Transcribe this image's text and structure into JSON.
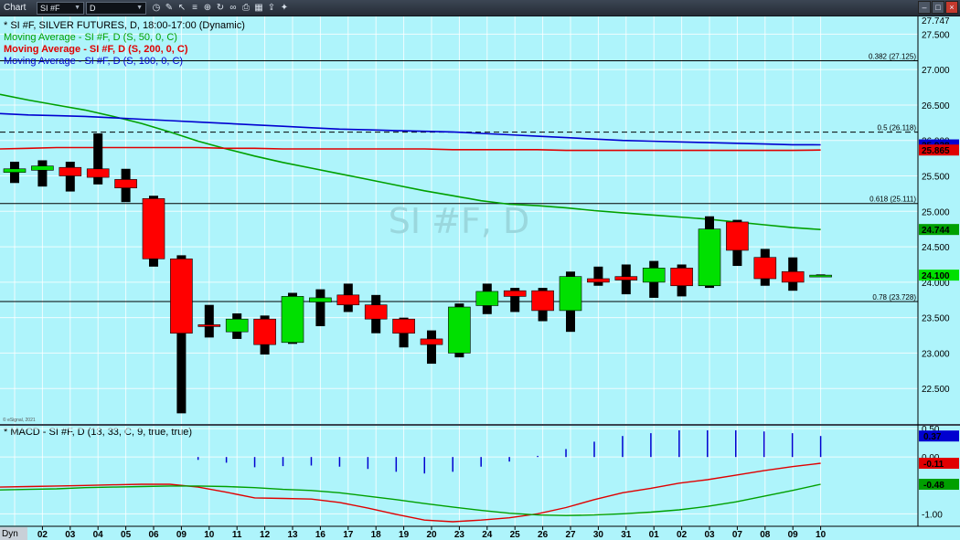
{
  "toolbar": {
    "title": "Chart",
    "symbol": "SI #F",
    "interval": "D"
  },
  "statusbar": {
    "label": "Dyn"
  },
  "colors": {
    "background": "#aef4fb",
    "up": "#00e000",
    "down": "#ff0000",
    "ma50": "#00a000",
    "ma200": "#e00000",
    "ma100": "#0000d0",
    "macd": "#e00000",
    "signal": "#00a000",
    "histogram": "#0000d0"
  },
  "chart_data": [
    {
      "type": "candlestick",
      "watermark": "SI #F, D",
      "legend": [
        "* SI #F, SILVER FUTURES, D, 18:00-17:00 (Dynamic)",
        "Moving Average - SI #F, D (S, 50, 0, C)",
        "Moving Average - SI #F, D (S, 200, 0, C)",
        "Moving Average - SI #F, D (S, 100, 0, C)"
      ],
      "copyright": "© eSignal, 2021",
      "ylim": [
        22.0,
        27.75
      ],
      "y_ticks": [
        22.5,
        23.0,
        23.5,
        24.0,
        24.5,
        25.0,
        25.5,
        26.0,
        26.5,
        27.0,
        27.5
      ],
      "y_tick_labels": [
        "22.500",
        "23.000",
        "23.500",
        "24.000",
        "24.500",
        "25.000",
        "25.500",
        "26.000",
        "26.500",
        "27.000",
        "27.500"
      ],
      "top_label": "27.747",
      "categories": [
        "02",
        "03",
        "04",
        "05",
        "06",
        "09",
        "10",
        "11",
        "12",
        "13",
        "16",
        "17",
        "18",
        "19",
        "20",
        "23",
        "24",
        "25",
        "26",
        "27",
        "30",
        "31",
        "01",
        "02",
        "03",
        "07",
        "08",
        "09",
        "10"
      ],
      "ohlc": [
        [
          25.55,
          25.7,
          25.4,
          25.6
        ],
        [
          25.58,
          25.72,
          25.35,
          25.64
        ],
        [
          25.62,
          25.7,
          25.28,
          25.5
        ],
        [
          25.6,
          26.1,
          25.38,
          25.48
        ],
        [
          25.45,
          25.6,
          25.13,
          25.33
        ],
        [
          25.18,
          25.22,
          24.22,
          24.33
        ],
        [
          24.33,
          24.38,
          22.15,
          23.28
        ],
        [
          23.4,
          23.68,
          23.22,
          23.38
        ],
        [
          23.3,
          23.56,
          23.2,
          23.48
        ],
        [
          23.48,
          23.53,
          22.98,
          23.12
        ],
        [
          23.15,
          23.85,
          23.13,
          23.8
        ],
        [
          23.72,
          23.9,
          23.38,
          23.78
        ],
        [
          23.82,
          23.98,
          23.58,
          23.68
        ],
        [
          23.68,
          23.82,
          23.28,
          23.48
        ],
        [
          23.48,
          23.5,
          23.08,
          23.28
        ],
        [
          23.2,
          23.32,
          22.85,
          23.12
        ],
        [
          23.0,
          23.7,
          22.94,
          23.65
        ],
        [
          23.67,
          23.98,
          23.55,
          23.87
        ],
        [
          23.88,
          23.92,
          23.58,
          23.8
        ],
        [
          23.88,
          23.92,
          23.45,
          23.6
        ],
        [
          23.6,
          24.15,
          23.3,
          24.08
        ],
        [
          24.05,
          24.22,
          23.95,
          24.0
        ],
        [
          24.08,
          24.25,
          23.83,
          24.03
        ],
        [
          24.0,
          24.3,
          23.78,
          24.2
        ],
        [
          24.2,
          24.25,
          23.8,
          23.95
        ],
        [
          23.95,
          24.93,
          23.92,
          24.75
        ],
        [
          24.85,
          24.88,
          24.23,
          24.45
        ],
        [
          24.35,
          24.47,
          23.95,
          24.05
        ],
        [
          24.15,
          24.35,
          23.88,
          24.0
        ],
        [
          24.1,
          24.11,
          24.09,
          24.1
        ]
      ],
      "ohlc_note": "",
      "series": [
        {
          "name": "Moving Average 50",
          "values": [
            26.65,
            26.57,
            26.5,
            26.43,
            26.34,
            26.24,
            26.12,
            25.99,
            25.88,
            25.78,
            25.69,
            25.61,
            25.53,
            25.45,
            25.37,
            25.29,
            25.22,
            25.15,
            25.1,
            25.08,
            25.05,
            25.01,
            24.98,
            24.95,
            24.92,
            24.89,
            24.85,
            24.81,
            24.77,
            24.744
          ]
        },
        {
          "name": "Moving Average 200",
          "values": [
            25.88,
            25.89,
            25.9,
            25.9,
            25.9,
            25.9,
            25.9,
            25.9,
            25.89,
            25.89,
            25.88,
            25.88,
            25.88,
            25.88,
            25.88,
            25.88,
            25.87,
            25.87,
            25.87,
            25.87,
            25.86,
            25.86,
            25.86,
            25.86,
            25.86,
            25.86,
            25.86,
            25.86,
            25.86,
            25.865
          ]
        },
        {
          "name": "Moving Average 100",
          "values": [
            26.38,
            26.36,
            26.35,
            26.34,
            26.32,
            26.3,
            26.28,
            26.26,
            26.24,
            26.22,
            26.2,
            26.18,
            26.16,
            26.15,
            26.14,
            26.13,
            26.12,
            26.1,
            26.08,
            26.06,
            26.04,
            26.02,
            26.0,
            25.99,
            25.98,
            25.97,
            25.96,
            25.95,
            25.94,
            25.938
          ]
        }
      ],
      "last_labels": [
        "25.938",
        "25.865",
        "24.744",
        "24.100"
      ],
      "fib_levels": [
        {
          "label": "0.382 (27.125)",
          "value": 27.125,
          "style": "solid"
        },
        {
          "label": "0.5 (26.118)",
          "value": 26.118,
          "style": "dashed"
        },
        {
          "label": "0.618 (25.111)",
          "value": 25.111,
          "style": "solid"
        },
        {
          "label": "0.78 (23.728)",
          "value": 23.728,
          "style": "solid"
        }
      ]
    },
    {
      "type": "line",
      "title": "* MACD - SI #F, D (13, 33, C, 9, true, true)",
      "ylim": [
        -1.22,
        0.55
      ],
      "y_ticks": [
        0.5,
        0.0,
        -1.0
      ],
      "y_tick_labels": [
        "0.50",
        "0.00",
        "-1.00"
      ],
      "last_labels": [
        "0.37",
        "-0.11",
        "-0.48"
      ],
      "series": [
        {
          "name": "MACD",
          "values": [
            -0.53,
            -0.52,
            -0.51,
            -0.5,
            -0.49,
            -0.48,
            -0.48,
            -0.53,
            -0.62,
            -0.72,
            -0.73,
            -0.74,
            -0.8,
            -0.9,
            -1.01,
            -1.11,
            -1.14,
            -1.11,
            -1.07,
            -1.0,
            -0.89,
            -0.75,
            -0.63,
            -0.55,
            -0.46,
            -0.4,
            -0.32,
            -0.24,
            -0.17,
            -0.11
          ]
        },
        {
          "name": "Signal",
          "values": [
            -0.58,
            -0.57,
            -0.56,
            -0.54,
            -0.53,
            -0.52,
            -0.51,
            -0.51,
            -0.52,
            -0.54,
            -0.57,
            -0.59,
            -0.63,
            -0.69,
            -0.75,
            -0.82,
            -0.88,
            -0.94,
            -0.99,
            -1.02,
            -1.03,
            -1.02,
            -1.0,
            -0.97,
            -0.93,
            -0.87,
            -0.79,
            -0.69,
            -0.59,
            -0.48
          ]
        },
        {
          "name": "Histogram",
          "values": [
            0,
            0,
            0,
            0,
            0,
            0,
            0,
            -0.05,
            -0.1,
            -0.18,
            -0.16,
            -0.15,
            -0.17,
            -0.21,
            -0.26,
            -0.29,
            -0.26,
            -0.17,
            -0.08,
            0.02,
            0.14,
            0.27,
            0.37,
            0.42,
            0.47,
            0.47,
            0.47,
            0.45,
            0.42,
            0.37
          ]
        }
      ]
    }
  ]
}
